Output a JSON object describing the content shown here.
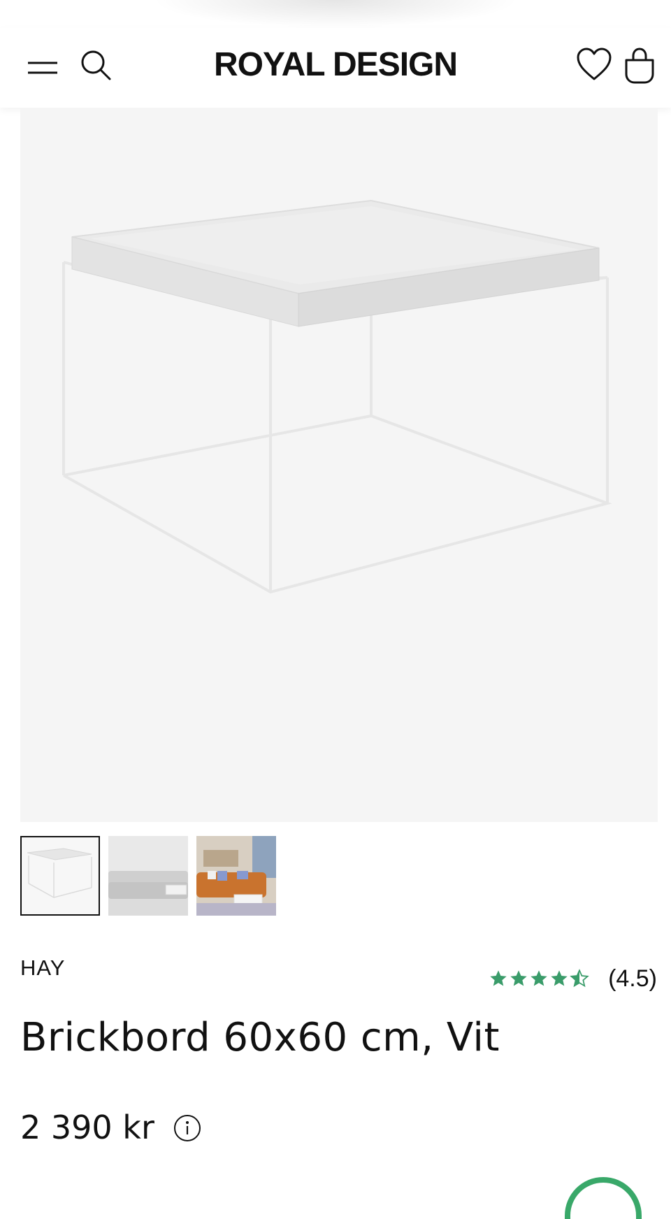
{
  "header": {
    "logo_text": "ROYAL DESIGN",
    "icons": [
      "menu-icon",
      "search-icon",
      "heart-icon",
      "shopping-bag-icon"
    ]
  },
  "gallery": {
    "thumbnails": [
      {
        "subject": "table-white",
        "active": true
      },
      {
        "subject": "grey-sofa",
        "active": false
      },
      {
        "subject": "orange-sofa-living-room",
        "active": false
      }
    ]
  },
  "product": {
    "brand": "HAY",
    "title": "Brickbord 60x60 cm, Vit",
    "price": "2 390 kr",
    "rating_text": "(4.5)",
    "rating_value": 4.5,
    "rating_max": 5
  },
  "colors": {
    "star": "#3a9c6a",
    "chat": "#39a869",
    "hero_bg": "#f5f5f5"
  }
}
